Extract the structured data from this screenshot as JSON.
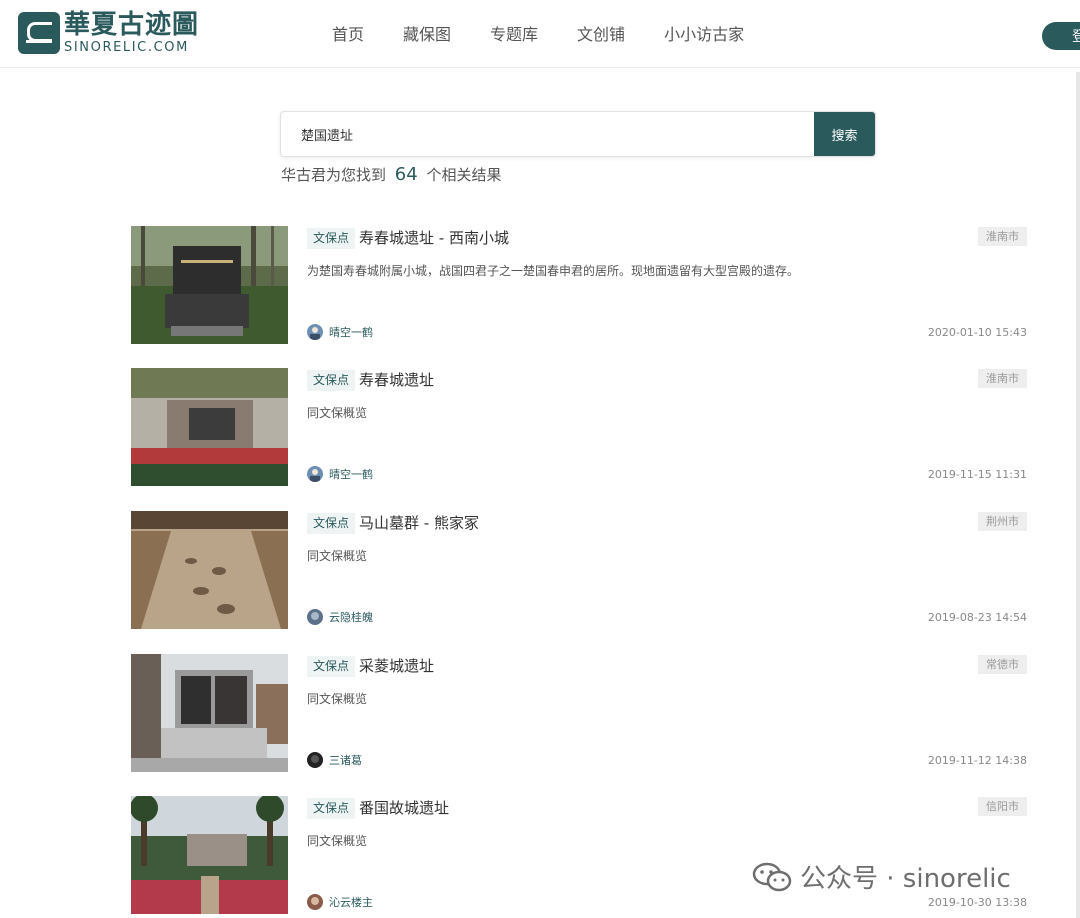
{
  "header": {
    "logo_cn": "華夏古迹圖",
    "logo_en": "SINORELIC.COM",
    "nav": [
      "首页",
      "藏保图",
      "专题库",
      "文创铺",
      "小小访古家"
    ],
    "login": "登录"
  },
  "search": {
    "query": "楚国遗址",
    "button": "搜索",
    "summary_prefix": "华古君为您找到",
    "count": "64",
    "summary_suffix": "个相关结果"
  },
  "results": [
    {
      "tag": "文保点",
      "title": "寿春城遗址 - 西南小城",
      "city": "淮南市",
      "desc": "为楚国寿春城附属小城，战国四君子之一楚国春申君的居所。现地面遗留有大型宫殿的遗存。",
      "author": "晴空一鹤",
      "date": "2020-01-10 15:43"
    },
    {
      "tag": "文保点",
      "title": "寿春城遗址",
      "city": "淮南市",
      "desc": "同文保概览",
      "author": "晴空一鹤",
      "date": "2019-11-15 11:31"
    },
    {
      "tag": "文保点",
      "title": "马山墓群 - 熊家冢",
      "city": "荆州市",
      "desc": "同文保概览",
      "author": "云隐桂魄",
      "date": "2019-08-23 14:54"
    },
    {
      "tag": "文保点",
      "title": "采菱城遗址",
      "city": "常德市",
      "desc": "同文保概览",
      "author": "三诸葛",
      "date": "2019-11-12 14:38"
    },
    {
      "tag": "文保点",
      "title": "番国故城遗址",
      "city": "信阳市",
      "desc": "同文保概览",
      "author": "沁云楼主",
      "date": "2019-10-30 13:38"
    }
  ],
  "watermark": {
    "text": "公众号 · sinorelic"
  },
  "colors": {
    "brand": "#2b5a5d",
    "tag_bg": "#eef4f4",
    "city_bg": "#eeeeee"
  }
}
